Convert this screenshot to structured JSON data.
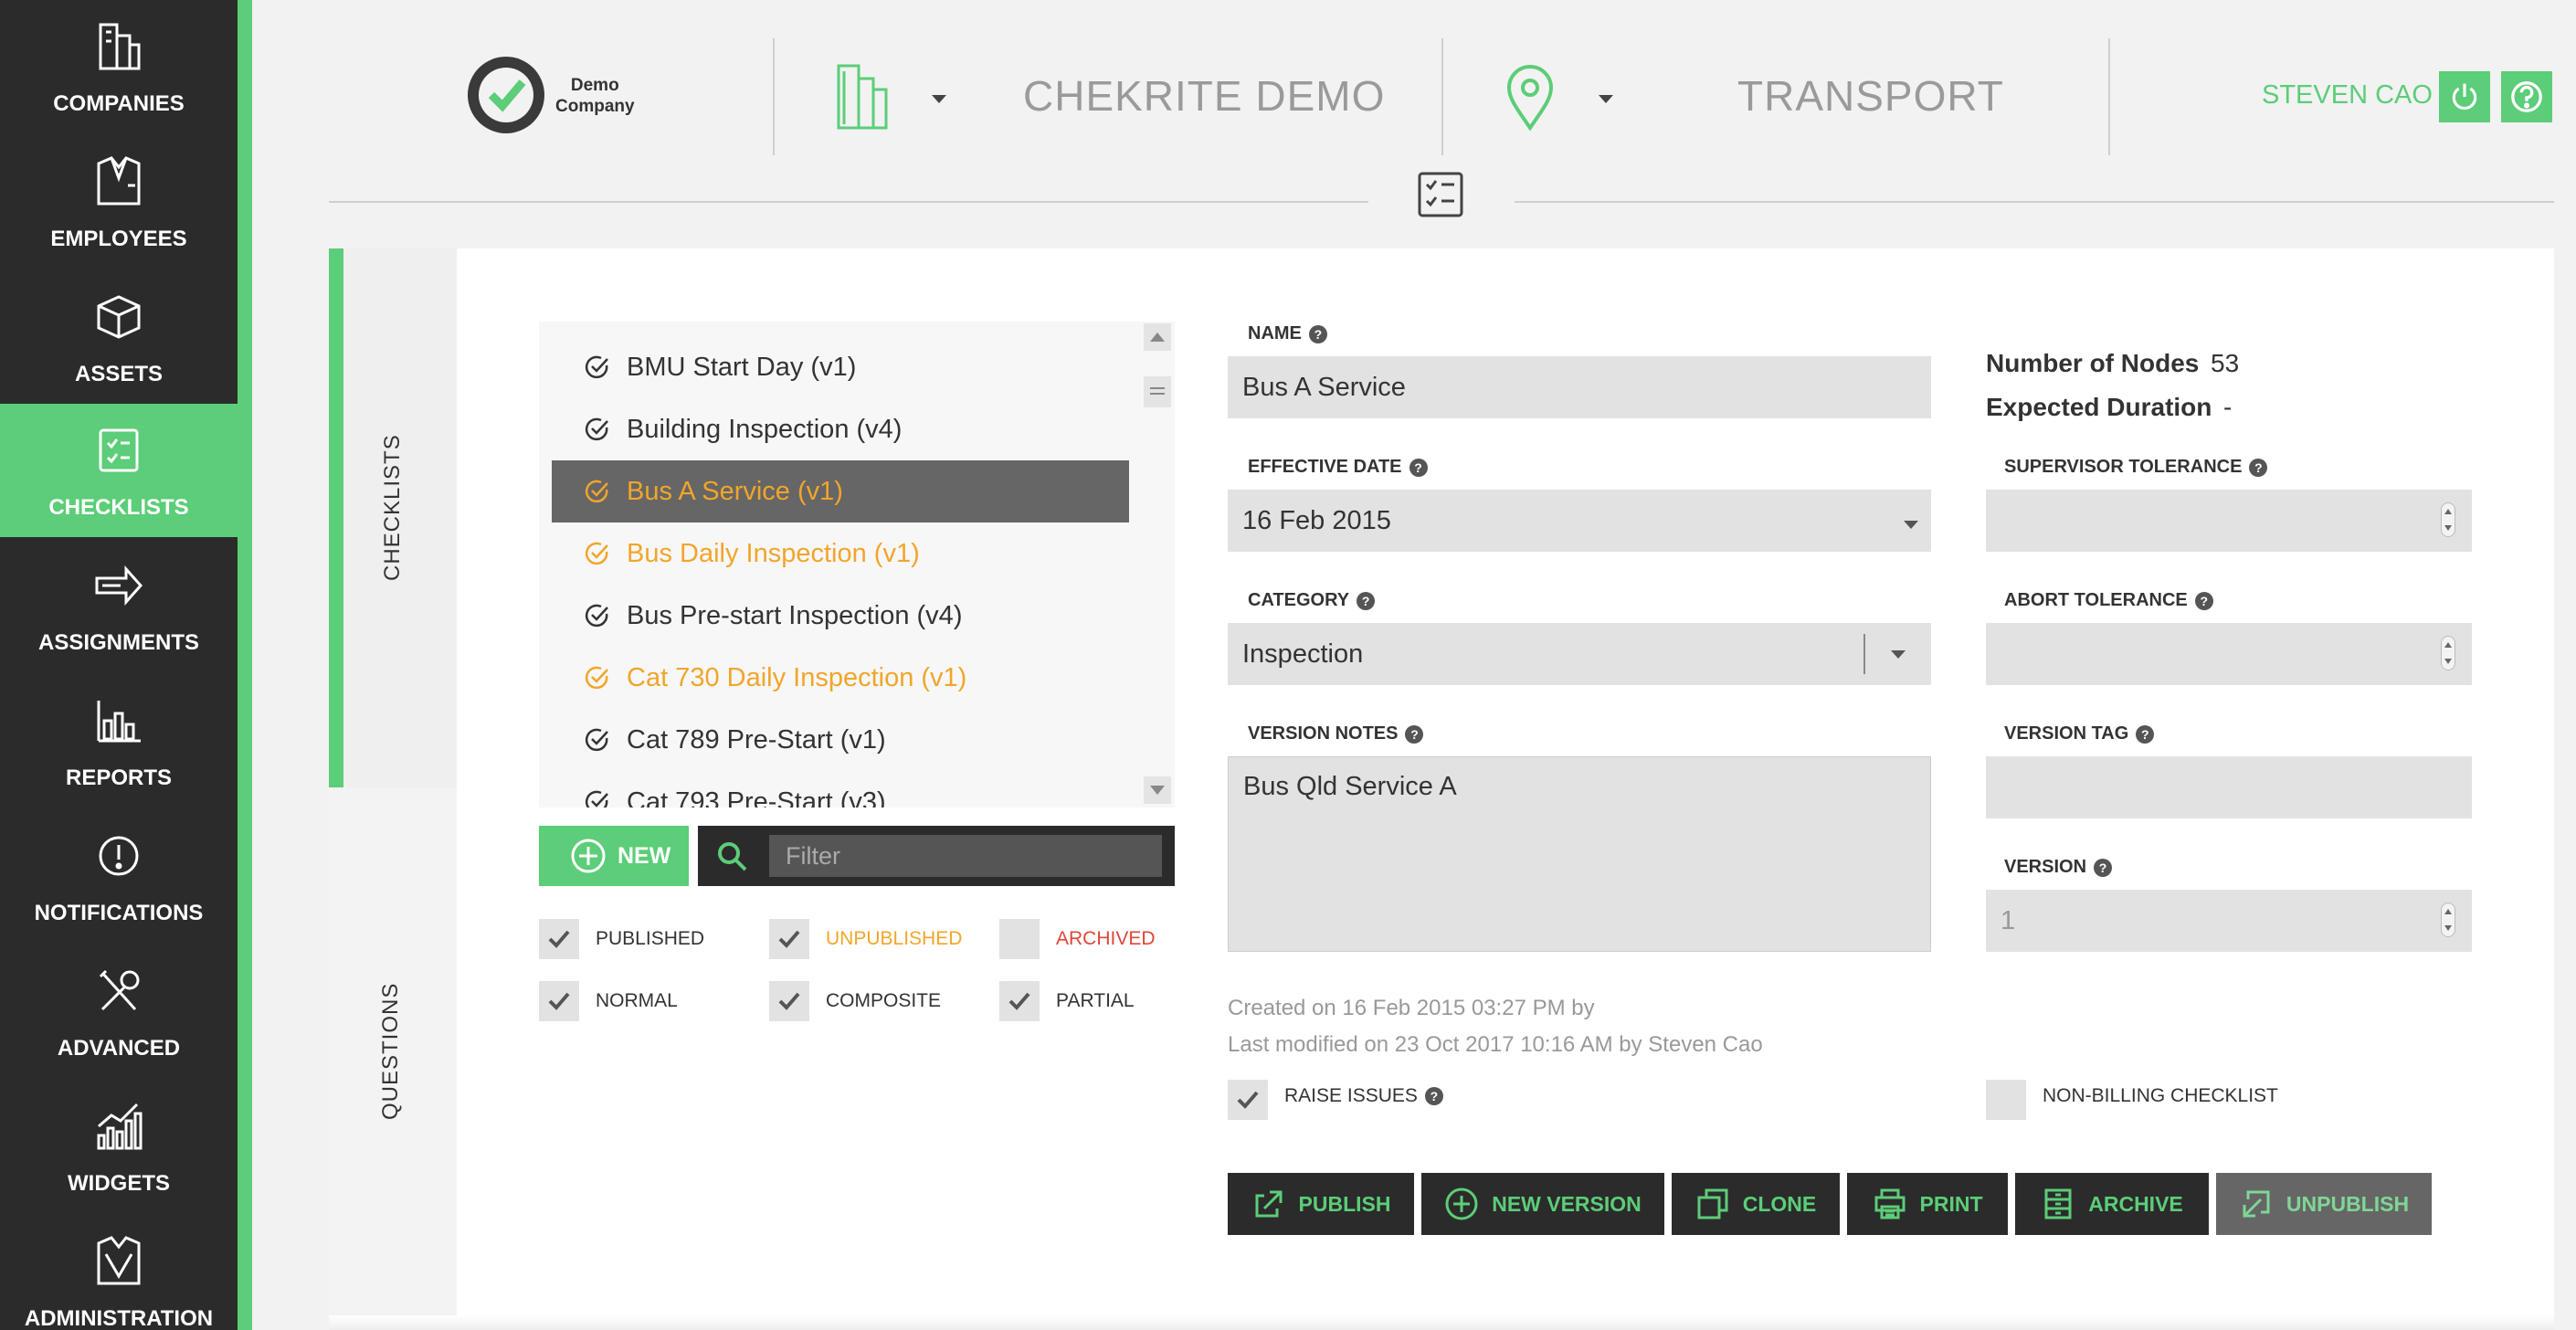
{
  "colors": {
    "accent": "#5ccd78",
    "dark": "#2b2b2b",
    "unpublished": "#f2a52a",
    "archived": "#e0453a"
  },
  "sidebar": {
    "items": [
      {
        "label": "COMPANIES",
        "icon": "companies-icon"
      },
      {
        "label": "EMPLOYEES",
        "icon": "employees-icon"
      },
      {
        "label": "ASSETS",
        "icon": "assets-icon"
      },
      {
        "label": "CHECKLISTS",
        "icon": "checklists-icon",
        "active": true
      },
      {
        "label": "ASSIGNMENTS",
        "icon": "assignments-icon"
      },
      {
        "label": "REPORTS",
        "icon": "reports-icon"
      },
      {
        "label": "NOTIFICATIONS",
        "icon": "notifications-icon"
      },
      {
        "label": "ADVANCED",
        "icon": "advanced-icon"
      },
      {
        "label": "WIDGETS",
        "icon": "widgets-icon"
      },
      {
        "label": "ADMINISTRATION",
        "icon": "administration-icon"
      }
    ]
  },
  "header": {
    "logo_line1": "Demo",
    "logo_line2": "Company",
    "company": "CHEKRITE DEMO",
    "site": "TRANSPORT",
    "user": "STEVEN CAO"
  },
  "tabs": {
    "checklists": "CHECKLISTS",
    "questions": "QUESTIONS"
  },
  "checklist_list": [
    {
      "name": "BMU Start Day (v1)",
      "status": "published"
    },
    {
      "name": "Building Inspection (v4)",
      "status": "published"
    },
    {
      "name": "Bus A Service (v1)",
      "status": "selected"
    },
    {
      "name": "Bus Daily Inspection (v1)",
      "status": "unpublished"
    },
    {
      "name": "Bus Pre-start Inspection (v4)",
      "status": "published"
    },
    {
      "name": "Cat 730 Daily Inspection (v1)",
      "status": "unpublished"
    },
    {
      "name": "Cat 789 Pre-Start (v1)",
      "status": "published"
    },
    {
      "name": "Cat 793 Pre-Start (v3)",
      "status": "published"
    }
  ],
  "list_controls": {
    "new_label": "NEW",
    "filter_placeholder": "Filter"
  },
  "filters": {
    "published": "PUBLISHED",
    "unpublished": "UNPUBLISHED",
    "archived": "ARCHIVED",
    "normal": "NORMAL",
    "composite": "COMPOSITE",
    "partial": "PARTIAL"
  },
  "form": {
    "name_label": "NAME",
    "name_value": "Bus A Service",
    "effective_date_label": "EFFECTIVE DATE",
    "effective_date_value": "16 Feb 2015",
    "category_label": "CATEGORY",
    "category_value": "Inspection",
    "version_notes_label": "VERSION NOTES",
    "version_notes_value": "Bus Qld Service A",
    "nodes_label": "Number of Nodes",
    "nodes_value": "53",
    "duration_label": "Expected Duration",
    "duration_value": "-",
    "supervisor_tolerance_label": "SUPERVISOR TOLERANCE",
    "abort_tolerance_label": "ABORT TOLERANCE",
    "version_tag_label": "VERSION TAG",
    "version_label": "VERSION",
    "version_value": "1",
    "created": "Created on 16 Feb 2015 03:27 PM by",
    "modified": "Last modified on 23 Oct 2017 10:16 AM by Steven Cao",
    "raise_issues_label": "RAISE ISSUES",
    "non_billing_label": "NON-BILLING CHECKLIST"
  },
  "actions": {
    "publish": "PUBLISH",
    "new_version": "NEW VERSION",
    "clone": "CLONE",
    "print": "PRINT",
    "archive": "ARCHIVE",
    "unpublish": "UNPUBLISH"
  }
}
